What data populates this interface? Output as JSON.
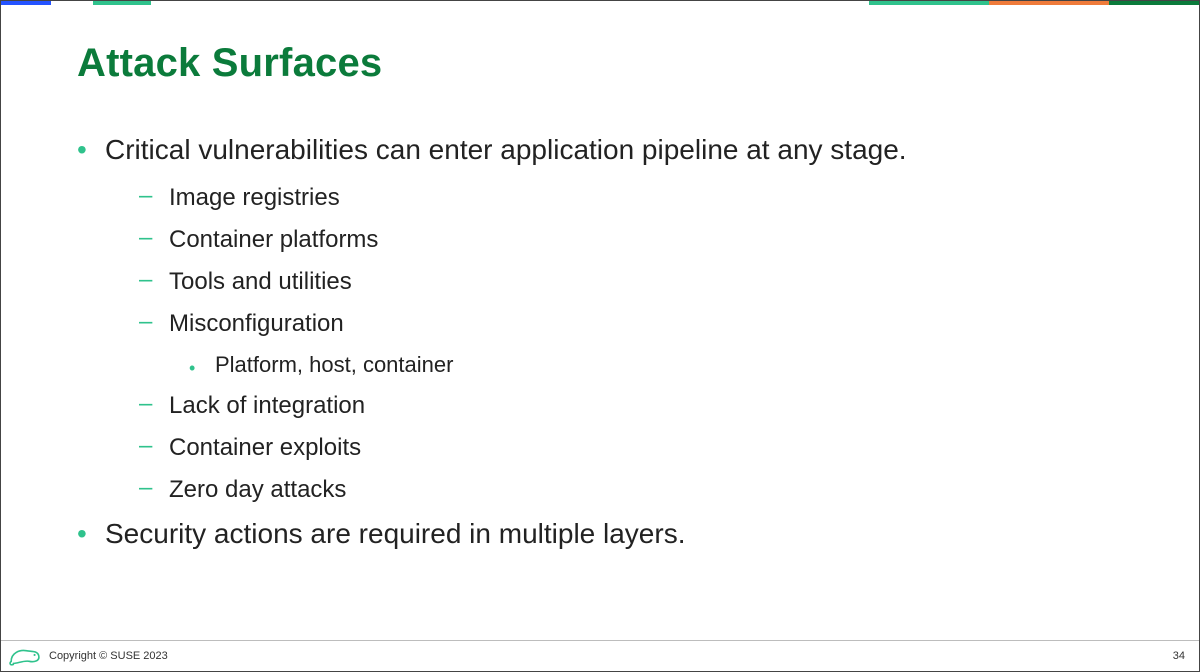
{
  "slide": {
    "title": "Attack Surfaces",
    "bullets": [
      {
        "text": "Critical vulnerabilities can enter application pipeline at any stage.",
        "sub": [
          {
            "text": "Image registries"
          },
          {
            "text": "Container platforms"
          },
          {
            "text": "Tools and utilities"
          },
          {
            "text": "Misconfiguration",
            "sub": [
              {
                "text": "Platform, host, container"
              }
            ]
          },
          {
            "text": "Lack of integration"
          },
          {
            "text": "Container exploits"
          },
          {
            "text": "Zero day attacks"
          }
        ]
      },
      {
        "text": "Security actions are required in multiple layers."
      }
    ]
  },
  "footer": {
    "copyright": "Copyright © SUSE 2023",
    "page_number": "34"
  },
  "colors": {
    "accent_green": "#2fc28c",
    "title_green": "#0b7b3b",
    "orange": "#ef7b3a",
    "blue": "#2453ff"
  }
}
